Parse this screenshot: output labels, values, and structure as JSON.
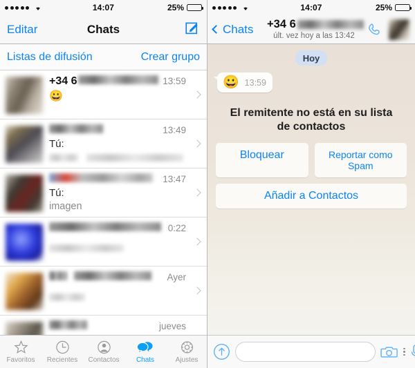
{
  "status_bar": {
    "signal_dots": 5,
    "wifi_icon": "wifi-icon",
    "time": "14:07",
    "battery_percent": "25%",
    "battery_level": 25
  },
  "left_panel": {
    "nav": {
      "edit_label": "Editar",
      "title": "Chats",
      "compose_icon": "compose-pencil-icon"
    },
    "broadcast": {
      "lists_label": "Listas de difusión",
      "create_group_label": "Crear grupo"
    },
    "chats": [
      {
        "name": "+34 6",
        "name_redacted": true,
        "time": "13:59",
        "preview_emoji": "😀",
        "preview": "",
        "avatar_class": "av1"
      },
      {
        "name": "",
        "name_redacted": true,
        "time": "13:49",
        "preview_prefix": "Tú:",
        "preview": "",
        "avatar_class": "av2"
      },
      {
        "name": "",
        "name_redacted": true,
        "time": "13:47",
        "preview_prefix": "Tú:",
        "preview": "imagen",
        "avatar_class": "av3"
      },
      {
        "name": "",
        "name_redacted": true,
        "time": "0:22",
        "preview": "",
        "avatar_class": "av4"
      },
      {
        "name": "",
        "name_redacted": true,
        "time": "Ayer",
        "preview": "",
        "avatar_class": "av5"
      },
      {
        "name": "",
        "name_redacted": true,
        "time": "jueves",
        "preview": "",
        "avatar_class": "av6"
      }
    ],
    "tabs": [
      {
        "label": "Favoritos",
        "icon": "star-icon",
        "active": false
      },
      {
        "label": "Recientes",
        "icon": "clock-icon",
        "active": false
      },
      {
        "label": "Contactos",
        "icon": "person-icon",
        "active": false
      },
      {
        "label": "Chats",
        "icon": "chat-bubbles-icon",
        "active": true
      },
      {
        "label": "Ajustes",
        "icon": "gear-icon",
        "active": false
      }
    ]
  },
  "right_panel": {
    "nav": {
      "back_label": "Chats",
      "back_icon": "chevron-left-icon",
      "title": "+34 6",
      "title_redacted": true,
      "subtitle": "últ. vez hoy a las 13:42",
      "call_icon": "phone-icon",
      "avatar": "contact-avatar"
    },
    "conversation": {
      "day_separator": "Hoy",
      "messages": [
        {
          "type": "incoming",
          "emoji": "😀",
          "time": "13:59"
        }
      ],
      "notice": "El remitente no está en su lista de contactos",
      "actions": [
        {
          "label": "Bloquear",
          "name": "block-button"
        },
        {
          "label": "Reportar como Spam",
          "name": "report-spam-button"
        },
        {
          "label": "Añadir a Contactos",
          "name": "add-contact-button"
        }
      ]
    },
    "input_bar": {
      "attach_icon": "arrow-up-circle-icon",
      "message_placeholder": "",
      "message_value": "",
      "camera_icon": "camera-icon",
      "more_icon": "more-dots-icon",
      "mic_icon": "microphone-icon"
    }
  },
  "colors": {
    "accent_blue": "#0b84f3",
    "tab_active_blue": "#0b9ff5",
    "chat_bg_top": "#e9e0d7",
    "chat_bg_bottom": "#f4f3ee",
    "day_pill": "#d3dff2"
  }
}
